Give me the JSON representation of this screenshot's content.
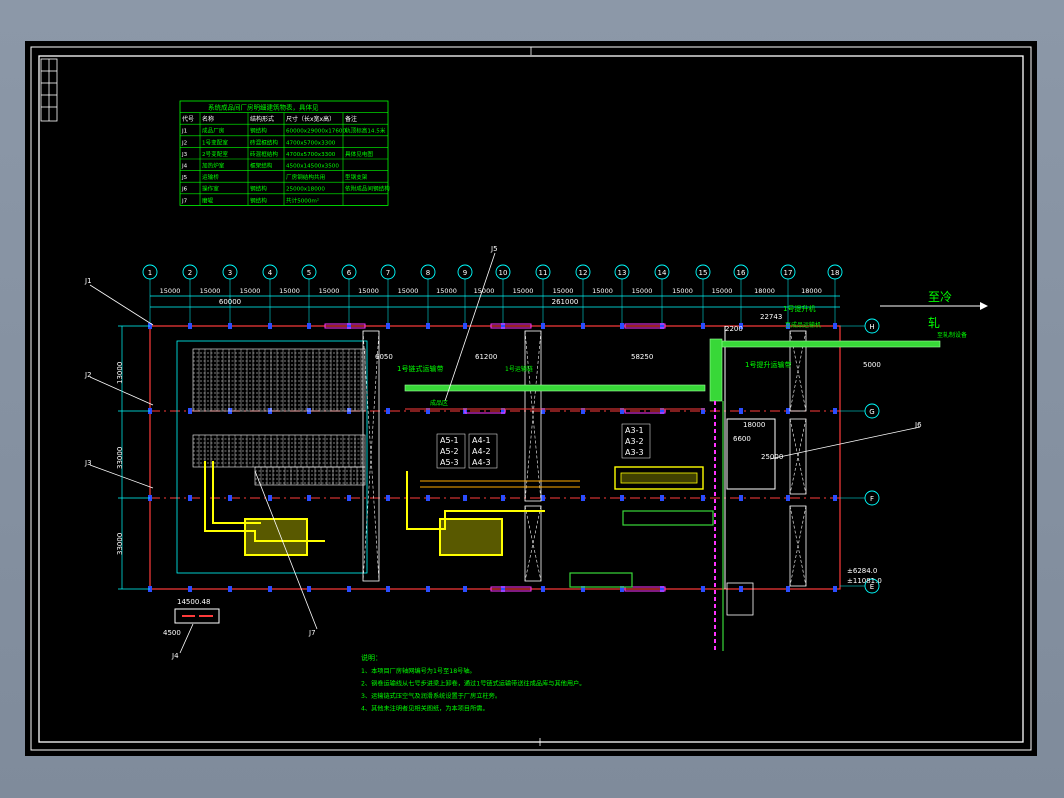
{
  "title_arrow_label": "至冷",
  "title_arrow_label_2": "轧",
  "top_dimensions": {
    "spans": [
      "15000",
      "15000",
      "15000",
      "15000",
      "15000",
      "15000",
      "15000",
      "15000",
      "15000",
      "15000",
      "15000",
      "15000",
      "15000",
      "15000",
      "15000",
      "18000",
      "18000"
    ],
    "group_left": "60000",
    "group_main": "261000"
  },
  "axis_numbers": [
    "1",
    "2",
    "3",
    "4",
    "5",
    "6",
    "7",
    "8",
    "9",
    "10",
    "11",
    "12",
    "13",
    "14",
    "15",
    "16",
    "17",
    "18"
  ],
  "row_axes": [
    "H",
    "G",
    "F",
    "E"
  ],
  "left_dimensions": [
    "13000",
    "33000",
    "33000"
  ],
  "table": {
    "title": "系统成品间厂房明细建筑物表，具体见",
    "headers": [
      "代号",
      "名称",
      "结构形式",
      "尺寸（长x宽x高）",
      "备注"
    ],
    "rows": [
      [
        "J1",
        "成品厂房",
        "钢结构",
        "60000x29000x17600",
        "轨顶标高14.5米"
      ],
      [
        "J2",
        "1号变配室",
        "砖混框结构",
        "4700x5700x3300",
        ""
      ],
      [
        "J3",
        "2号变配室",
        "砖混框结构",
        "4700x5700x3300",
        "具体见电图"
      ],
      [
        "J4",
        "加热炉室",
        "框架结构",
        "4500x14500x3500",
        ""
      ],
      [
        "J5",
        "运输桥",
        "",
        "厂房钢结构共用",
        "型钢支架"
      ],
      [
        "J6",
        "操作室",
        "钢结构",
        "25000x18000",
        "依附成品间钢结构"
      ],
      [
        "J7",
        "磨辊",
        "钢结构",
        "共计5000m²",
        ""
      ]
    ]
  },
  "callouts": [
    "J1",
    "J2",
    "J3",
    "J4",
    "J5",
    "J6",
    "J7"
  ],
  "conveyor_labels": {
    "left_length": "6050",
    "mid_length": "61200",
    "right_length": "58250",
    "label_a": "1号链式运输带",
    "label_b": "1号运输链",
    "label_c": "1号提升运输带",
    "label_d": "至成品运输机",
    "label_e": "至轧制设备",
    "label_f": "成品区",
    "label_g": "1号提升机",
    "right_dim_1": "22743",
    "right_dim_2": "2200",
    "right_dim_3": "5000",
    "j6_dim_a": "6600",
    "j6_dim_b": "18000",
    "j6_dim_c": "25000",
    "small_box_dim": "14500.48",
    "small_box_h": "4500",
    "elev_label": "±6284.0",
    "elev_label_2": "±11081.0"
  },
  "zone_labels_left": [
    "A5-1",
    "A5-2",
    "A5-3"
  ],
  "zone_labels_mid": [
    "A4-1",
    "A4-2",
    "A4-3"
  ],
  "zone_labels_right": [
    "A3-1",
    "A3-2",
    "A3-3"
  ],
  "notes": {
    "heading": "说明：",
    "lines": [
      "1、本项目厂房轴网编号为1号至18号轴。",
      "2、钢卷运输线从七号步进梁上卸卷，通过1号链式运输带送往成品库与其他用户。",
      "3、运输链式压空气及润滑系统设置于厂房立柱旁。",
      "4、其他未注明者见相关图纸，为本项目所需。"
    ]
  },
  "colors": {
    "frame": "#ffffff",
    "building": "#ff3b3b",
    "column": "#2b4dff",
    "dimension": "#00ffff",
    "conveyor": "#38d838",
    "equipment": "#ffff00",
    "text_green": "#00ff00",
    "crane": "#ff33ff"
  }
}
